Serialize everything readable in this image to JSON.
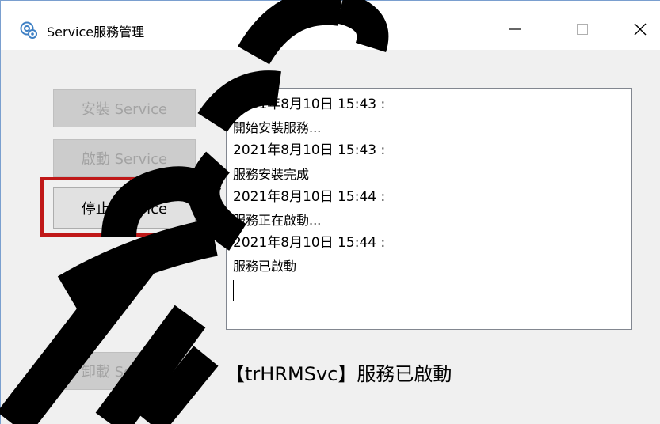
{
  "window": {
    "title": "Service服務管理",
    "icon": "service-gear-icon",
    "controls": {
      "minimize": "minimize-icon",
      "maximize": "maximize-icon",
      "close": "close-icon"
    }
  },
  "buttons": {
    "install": {
      "label": "安裝 Service",
      "state": "disabled"
    },
    "start": {
      "label": "啟動 Service",
      "state": "disabled"
    },
    "stop": {
      "label": "停止 Service",
      "state": "enabled",
      "highlighted": true
    },
    "uninstall": {
      "label": "卸載 Service",
      "state": "disabled"
    }
  },
  "log": {
    "lines": [
      "2021年8月10日 15:43 :",
      "開始安裝服務...",
      "2021年8月10日 15:43 :",
      "服務安裝完成",
      "2021年8月10日 15:44 :",
      "服務正在啟動...",
      "2021年8月10日 15:44 :",
      "服務已啟動"
    ]
  },
  "status_text": "【trHRMSvc】服務已啟動",
  "colors": {
    "highlight_border": "#c01818",
    "disabled_button": "#cccccc",
    "disabled_text": "#a3a3a3",
    "watermark": "#000000"
  }
}
